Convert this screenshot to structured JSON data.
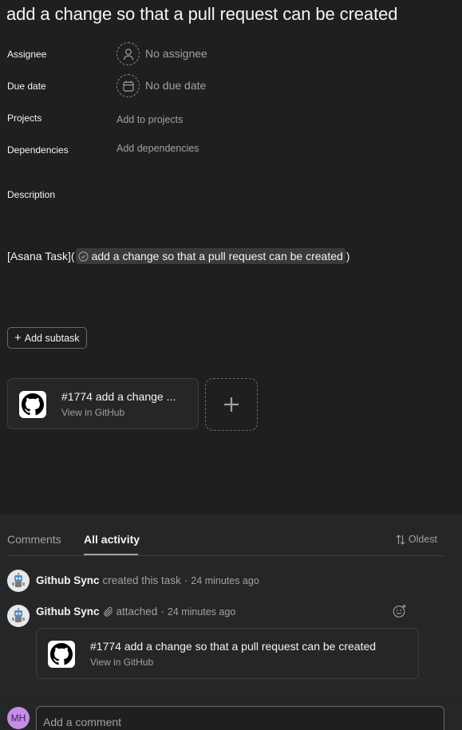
{
  "task": {
    "title": "add a change so that a pull request can be created"
  },
  "fields": {
    "assignee_label": "Assignee",
    "assignee_value": "No assignee",
    "due_label": "Due date",
    "due_value": "No due date",
    "projects_label": "Projects",
    "projects_value": "Add to projects",
    "dependencies_label": "Dependencies",
    "dependencies_value": "Add dependencies",
    "description_label": "Description"
  },
  "description": {
    "prefix": "[Asana Task](",
    "task_link": "add a change so that a pull request can be created",
    "suffix": ")"
  },
  "subtask": {
    "plus": "+",
    "label": "Add subtask"
  },
  "attachments": [
    {
      "title": "#1774 add a change ...",
      "subtitle": "View in GitHub",
      "icon": "github-icon"
    }
  ],
  "add_attachment_icon": "plus-icon",
  "activity": {
    "tabs": [
      {
        "label": "Comments",
        "active": false
      },
      {
        "label": "All activity",
        "active": true
      }
    ],
    "sort_label": "Oldest",
    "sort_icon": "sort-arrows-icon",
    "entries": [
      {
        "author": "Github Sync",
        "action": "created this task",
        "separator": "·",
        "time": "24 minutes ago"
      },
      {
        "author": "Github Sync",
        "action": "attached",
        "separator": "·",
        "time": "24 minutes ago",
        "icon": "paperclip-icon"
      }
    ],
    "attachment_card": {
      "title": "#1774 add a change so that a pull request can be created",
      "subtitle": "View in GitHub"
    }
  },
  "composer": {
    "avatar_initials": "MH",
    "placeholder": "Add a comment"
  },
  "colors": {
    "background": "#1e1f21",
    "panel": "#252628",
    "text_primary": "#f5f4f3",
    "text_secondary": "#a2a0a2",
    "avatar_mh": "#c58ee6"
  }
}
